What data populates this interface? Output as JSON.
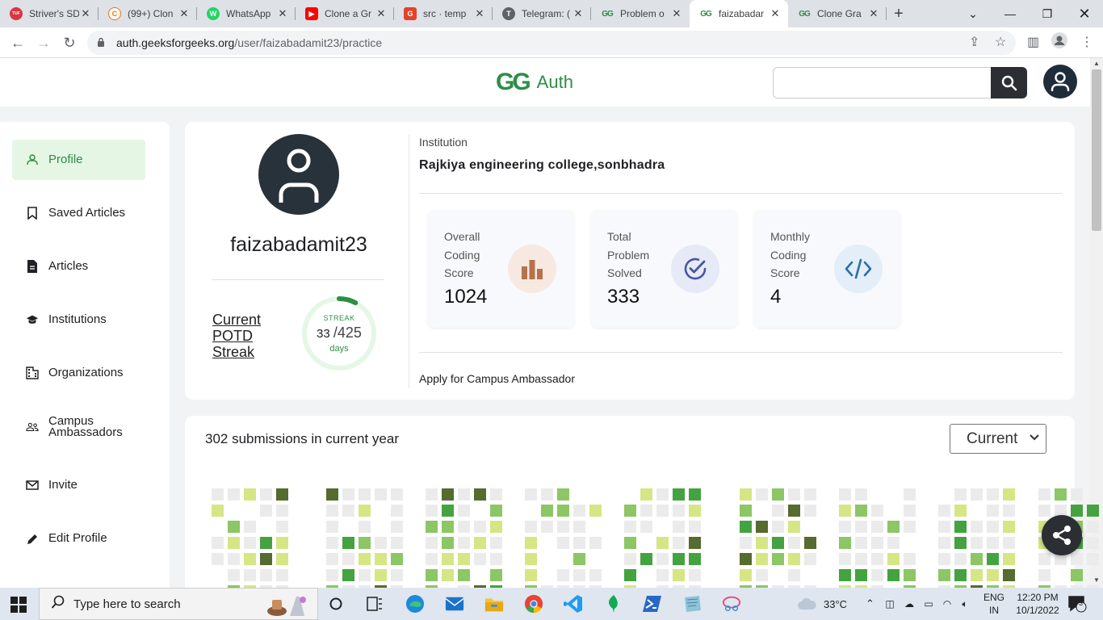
{
  "browser": {
    "tabs": [
      {
        "title": "Striver's SD",
        "favicon": "TUF",
        "color": "#d9363e",
        "active": false
      },
      {
        "title": "(99+) Clon",
        "favicon": "C",
        "color": "#ffffff",
        "active": false
      },
      {
        "title": "WhatsApp",
        "favicon": "W",
        "color": "#25d366",
        "active": false
      },
      {
        "title": "Clone a Gr",
        "favicon": "▶",
        "color": "#ff0000",
        "active": false
      },
      {
        "title": "src · temp",
        "favicon": "G",
        "color": "#e24329",
        "active": false
      },
      {
        "title": "Telegram: (",
        "favicon": "T",
        "color": "#5f6368",
        "active": false
      },
      {
        "title": "Problem o",
        "favicon": "GG",
        "color": "#2f8d46",
        "active": false
      },
      {
        "title": "faizabadar",
        "favicon": "GG",
        "color": "#2f8d46",
        "active": true
      },
      {
        "title": "Clone Gra",
        "favicon": "GG",
        "color": "#2f8d46",
        "active": false
      }
    ],
    "url_host": "auth.geeksforgeeks.org",
    "url_path": "/user/faizabadamit23/practice"
  },
  "header": {
    "logo_mark": "GG",
    "logo_text": "Auth",
    "search_placeholder": ""
  },
  "sidebar": {
    "items": [
      {
        "label": "Profile",
        "icon": "person-icon",
        "active": true
      },
      {
        "label": "Saved Articles",
        "icon": "bookmark-icon",
        "active": false
      },
      {
        "label": "Articles",
        "icon": "document-icon",
        "active": false
      },
      {
        "label": "Institutions",
        "icon": "graduation-cap-icon",
        "active": false
      },
      {
        "label": "Organizations",
        "icon": "building-icon",
        "active": false
      },
      {
        "label": "Campus\nAmbassadors",
        "icon": "group-icon",
        "active": false
      },
      {
        "label": "Invite",
        "icon": "mail-icon",
        "active": false
      },
      {
        "label": "Edit Profile",
        "icon": "pencil-icon",
        "active": false
      }
    ]
  },
  "profile": {
    "username": "faizabadamit23",
    "streak_label": "Current POTD Streak",
    "streak_title": "STREAK",
    "streak_current": "33",
    "streak_total": "/425",
    "streak_unit": "days",
    "streak_fraction": 0.078,
    "institution_label": "Institution",
    "institution_name": "Rajkiya engineering college,sonbhadra",
    "ambassador_link": "Apply for Campus Ambassador",
    "stats": [
      {
        "label": "Overall Coding Score",
        "value": "1024",
        "icon": "bar-chart-icon",
        "icon_bg": "#f7e9e1",
        "icon_color": "#b5724b"
      },
      {
        "label": "Total Problem Solved",
        "value": "333",
        "icon": "check-circle-icon",
        "icon_bg": "#e6eaf7",
        "icon_color": "#4a55a2"
      },
      {
        "label": "Monthly Coding Score",
        "value": "4",
        "icon": "code-icon",
        "icon_bg": "#e3eef8",
        "icon_color": "#2d6fa6"
      }
    ]
  },
  "submissions": {
    "title": "302 submissions in current year",
    "year_selected": "Current",
    "colors": [
      "#ebebeb",
      "#d6e685",
      "#8cc665",
      "#44a340",
      "#556b2f"
    ]
  },
  "taskbar": {
    "search_placeholder": "Type here to search",
    "weather": "33°C",
    "lang_top": "ENG",
    "lang_bottom": "IN",
    "time": "12:20 PM",
    "date": "10/1/2022",
    "notifications": "3"
  }
}
